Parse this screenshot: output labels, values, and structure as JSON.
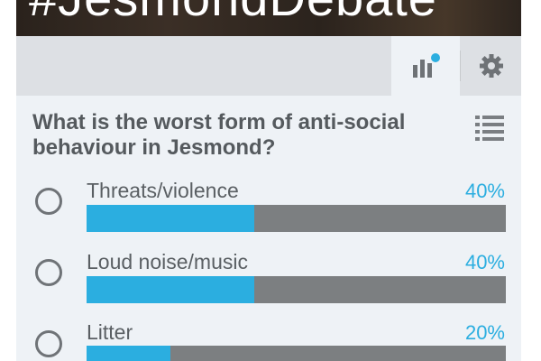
{
  "banner": {
    "hashtag": "#JesmondDebate"
  },
  "toolbar": {
    "results_icon": "bar-chart-icon",
    "settings_icon": "gear-icon",
    "notification_color": "#2baee0"
  },
  "poll": {
    "question": "What is the worst form of anti-social behaviour in Jesmond?",
    "menu_icon": "list-icon",
    "options": [
      {
        "label": "Threats/violence",
        "percent_text": "40%",
        "percent": 40
      },
      {
        "label": "Loud noise/music",
        "percent_text": "40%",
        "percent": 40
      },
      {
        "label": "Litter",
        "percent_text": "20%",
        "percent": 20
      }
    ]
  },
  "colors": {
    "accent": "#2baee0",
    "bar_track": "#7c7f81",
    "panel": "#eef2f6",
    "toolbar": "#dde0e4",
    "text": "#555a5e"
  }
}
